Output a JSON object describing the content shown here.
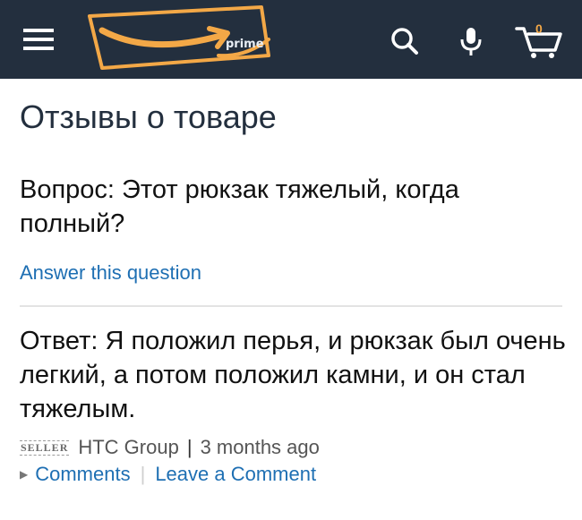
{
  "header": {
    "menu_icon": "hamburger-icon",
    "logo_text": "prime",
    "search_icon": "search-icon",
    "mic_icon": "microphone-icon",
    "cart_icon": "cart-icon",
    "cart_count": "0",
    "colors": {
      "bar": "#232f3e",
      "accent": "#f3a847"
    }
  },
  "page": {
    "title": "Отзывы о товаре"
  },
  "question": {
    "text": "Вопрос: Этот рюкзак тяжелый, когда полный?",
    "answer_link": "Answer this question"
  },
  "answer": {
    "text": "Ответ: Я положил перья, и рюкзак был очень легкий, а потом положил камни, и он стал тяжелым.",
    "badge": "SELLER",
    "author": "HTC Group",
    "separator": "|",
    "time": "3 months ago",
    "comments_link": "Comments",
    "leave_comment_link": "Leave a Comment",
    "link_color": "#1e6fb3"
  }
}
